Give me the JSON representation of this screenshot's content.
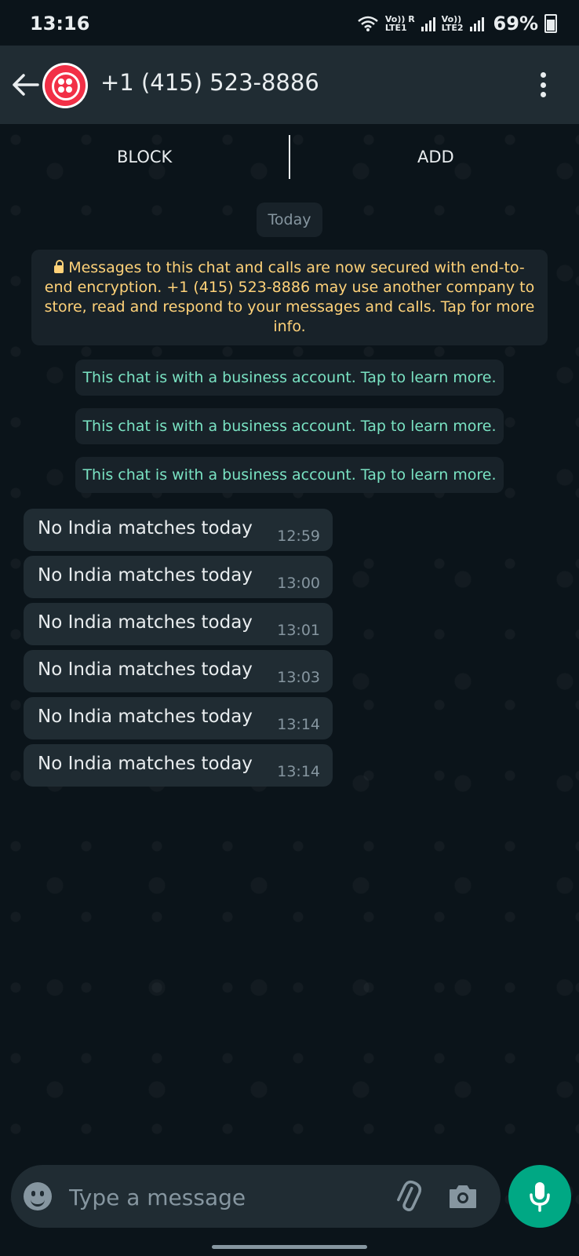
{
  "status_bar": {
    "time": "13:16",
    "sim1_label": "Vo)) R\nLTE1",
    "sim2_label": "Vo))\nLTE2",
    "battery": "69%"
  },
  "header": {
    "contact_name": "+1 (415) 523-8886",
    "back_icon": "arrow-left-icon",
    "menu_icon": "more-vertical-icon"
  },
  "actions": {
    "block_label": "BLOCK",
    "add_label": "ADD"
  },
  "chat": {
    "date_chip": "Today",
    "encryption_notice": "Messages to this chat and calls are now secured with end-to-end encryption. +1 (415) 523-8886 may use another company to store, read and respond to your messages and calls. Tap for more info.",
    "business_notices": [
      "This chat is with a business account. Tap to learn more.",
      "This chat is with a business account. Tap to learn more.",
      "This chat is with a business account. Tap to learn more."
    ],
    "messages": [
      {
        "text": "No India matches today",
        "time": "12:59"
      },
      {
        "text": "No India matches today",
        "time": "13:00"
      },
      {
        "text": "No India matches today",
        "time": "13:01"
      },
      {
        "text": "No India matches today",
        "time": "13:03"
      },
      {
        "text": "No India matches today",
        "time": "13:14"
      },
      {
        "text": "No India matches today",
        "time": "13:14"
      }
    ]
  },
  "composer": {
    "placeholder": "Type a message",
    "emoji_icon": "emoji-icon",
    "attach_icon": "paperclip-icon",
    "camera_icon": "camera-icon",
    "mic_icon": "microphone-icon"
  },
  "colors": {
    "background": "#0b141a",
    "header": "#202c33",
    "bubble": "#202c33",
    "accent": "#00a884",
    "system_yellow": "#ffd279",
    "business_green": "#7ae3c3"
  }
}
